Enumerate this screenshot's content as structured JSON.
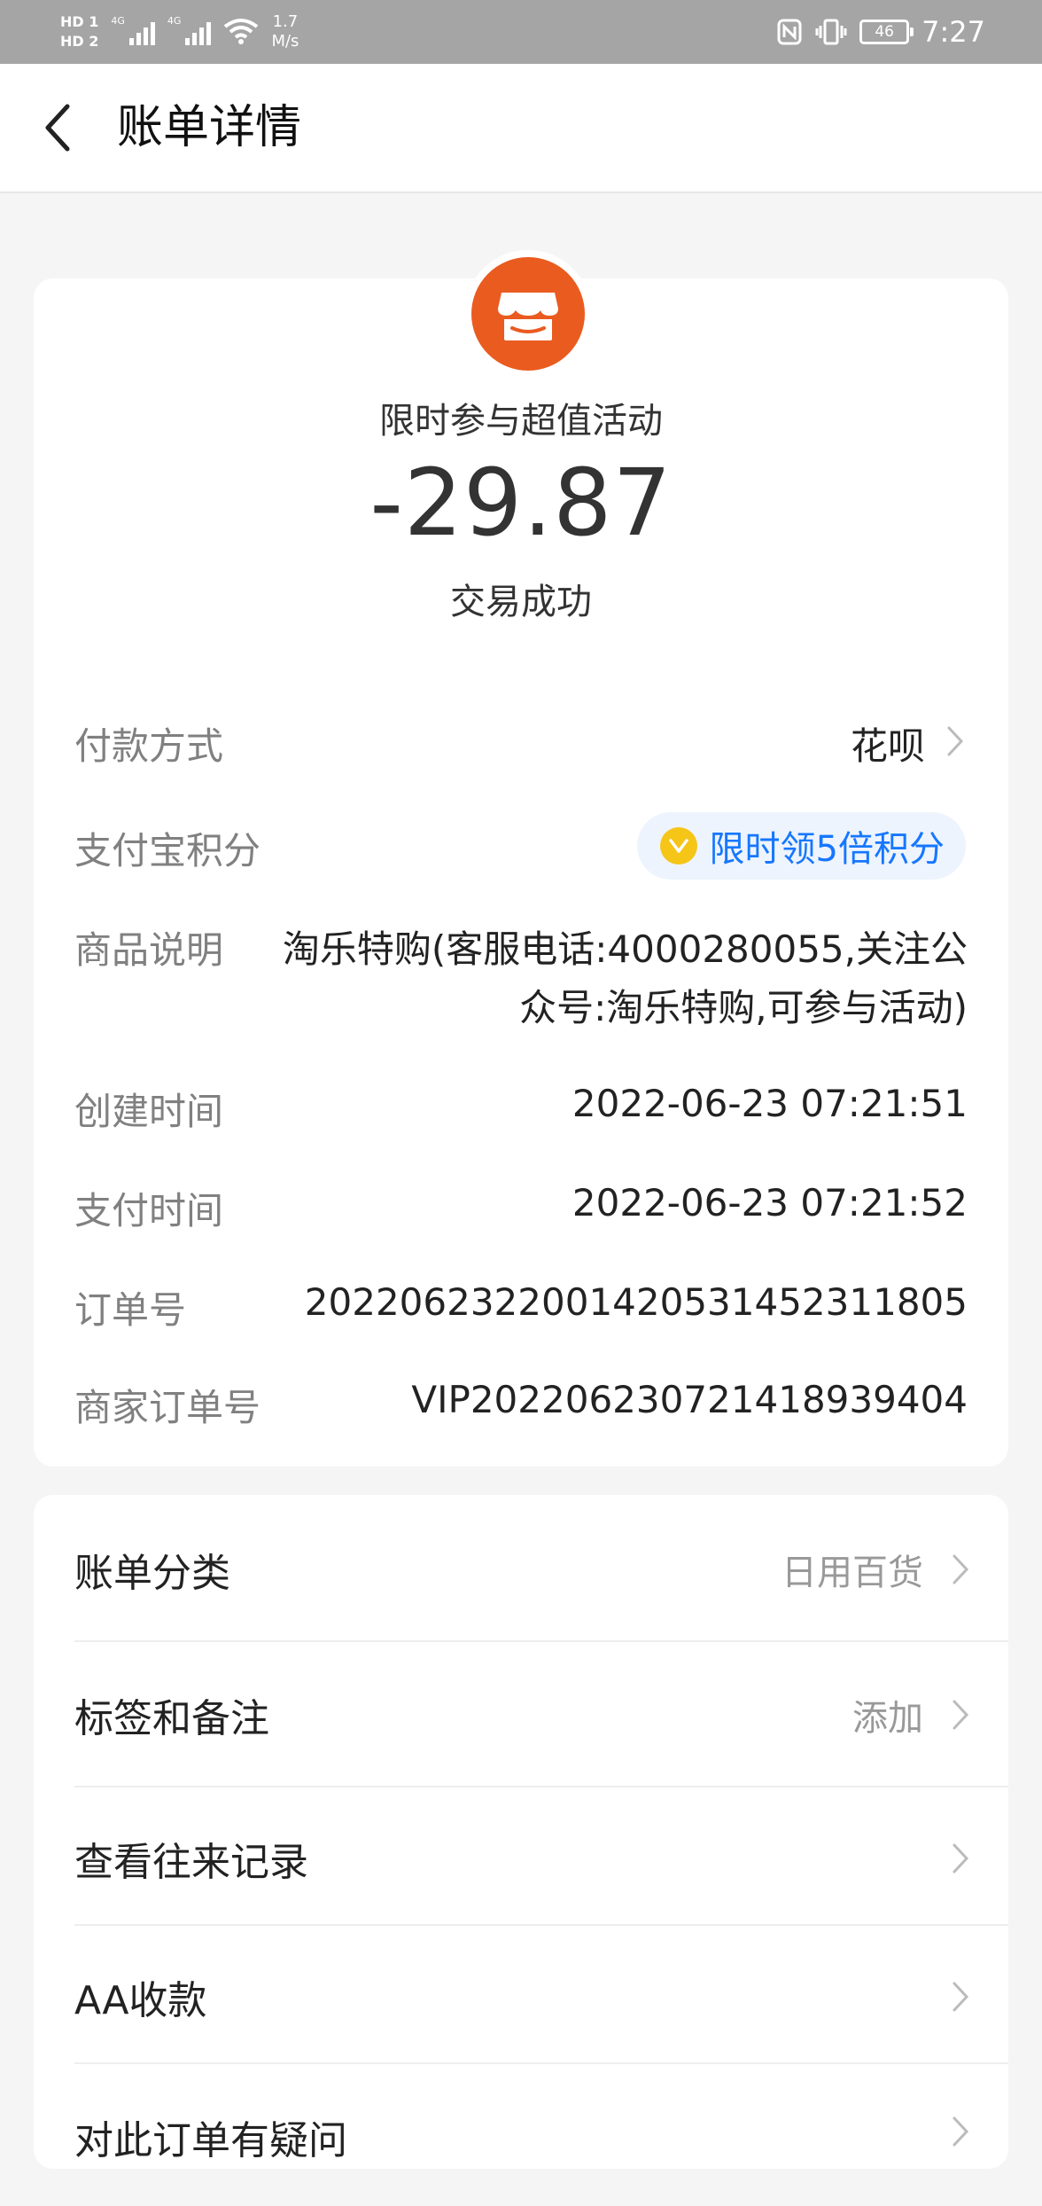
{
  "status_bar": {
    "hd1": "HD 1",
    "hd2": "HD 2",
    "net1": "4G",
    "net2": "4G",
    "speed_value": "1.7",
    "speed_unit": "M/s",
    "battery": "46",
    "time": "7:27"
  },
  "header": {
    "title": "账单详情"
  },
  "bill": {
    "merchant": "限时参与超值活动",
    "amount": "-29.87",
    "status": "交易成功",
    "payment_method_label": "付款方式",
    "payment_method_value": "花呗",
    "points_label": "支付宝积分",
    "points_promo": "限时领5倍积分",
    "desc_label": "商品说明",
    "desc_value": "淘乐特购(客服电话:4000280055,关注公众号:淘乐特购,可参与活动)",
    "created_label": "创建时间",
    "created_value": "2022-06-23 07:21:51",
    "paid_label": "支付时间",
    "paid_value": "2022-06-23 07:21:52",
    "order_label": "订单号",
    "order_value": "2022062322001420531452311805",
    "merchant_order_label": "商家订单号",
    "merchant_order_value": "VIP20220623072141893940​4"
  },
  "actions": [
    {
      "label": "账单分类",
      "value": "日用百货"
    },
    {
      "label": "标签和备注",
      "value": "添加"
    },
    {
      "label": "查看往来记录",
      "value": ""
    },
    {
      "label": "AA收款",
      "value": ""
    },
    {
      "label": "对此订单有疑问",
      "value": ""
    }
  ],
  "colors": {
    "brand_orange": "#ea5b20",
    "link_blue": "#1677ff",
    "status_bar": "#a5a5a5"
  }
}
